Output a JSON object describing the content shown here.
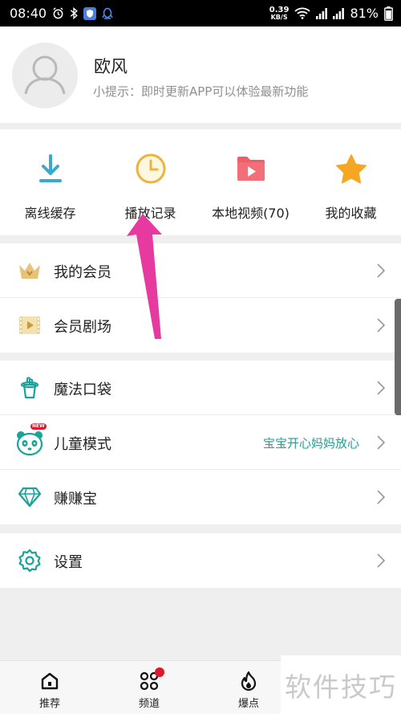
{
  "status_bar": {
    "time": "08:40",
    "net_speed_value": "0.39",
    "net_speed_unit": "KB/S",
    "battery": "81%"
  },
  "profile": {
    "username": "欧风",
    "hint": "小提示：即时更新APP可以体验最新功能"
  },
  "quick_actions": [
    {
      "label": "离线缓存",
      "icon": "download-icon"
    },
    {
      "label": "播放记录",
      "icon": "clock-icon"
    },
    {
      "label": "本地视频(70)",
      "icon": "local-video-folder-icon"
    },
    {
      "label": "我的收藏",
      "icon": "star-icon"
    }
  ],
  "menu": {
    "vip": {
      "label": "我的会员",
      "icon": "crown-icon"
    },
    "vip_theater": {
      "label": "会员剧场",
      "icon": "film-icon"
    },
    "magic_bag": {
      "label": "魔法口袋",
      "icon": "magic-hat-icon"
    },
    "kids_mode": {
      "label": "儿童模式",
      "icon": "panda-icon",
      "badge": "NEW",
      "right_text": "宝宝开心妈妈放心"
    },
    "earn": {
      "label": "赚赚宝",
      "icon": "diamond-icon"
    },
    "settings": {
      "label": "设置",
      "icon": "gear-icon"
    }
  },
  "bottom_nav": [
    {
      "label": "推荐",
      "icon": "home-icon"
    },
    {
      "label": "频道",
      "icon": "channels-icon"
    },
    {
      "label": "爆点",
      "icon": "flame-icon"
    }
  ],
  "watermark": "软件技巧",
  "colors": {
    "teal": "#1aa39a",
    "gold": "#e9b43f",
    "red_folder": "#ef5d68",
    "star": "#f5a623",
    "annotation_arrow": "#e63aa0"
  }
}
